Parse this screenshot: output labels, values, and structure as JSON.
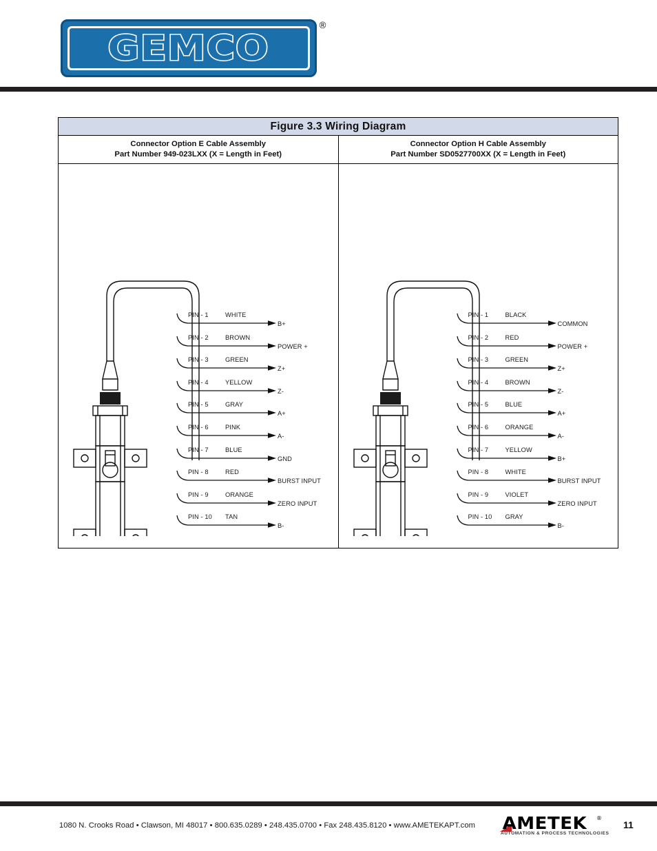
{
  "header": {
    "logo_text": "GEMCO",
    "logo_registered_mark": "®"
  },
  "figure": {
    "title": "Figure 3.3  Wiring Diagram",
    "columns": [
      {
        "heading_line1": "Connector Option E Cable Assembly",
        "heading_line2": "Part Number 949-023LXX  (X = Length in Feet)",
        "pins": [
          {
            "pin": "PIN - 1",
            "color": "WHITE",
            "signal": "B+"
          },
          {
            "pin": "PIN - 2",
            "color": "BROWN",
            "signal": "POWER +"
          },
          {
            "pin": "PIN - 3",
            "color": "GREEN",
            "signal": "Z+"
          },
          {
            "pin": "PIN - 4",
            "color": "YELLOW",
            "signal": "Z-"
          },
          {
            "pin": "PIN - 5",
            "color": "GRAY",
            "signal": "A+"
          },
          {
            "pin": "PIN - 6",
            "color": "PINK",
            "signal": "A-"
          },
          {
            "pin": "PIN - 7",
            "color": "BLUE",
            "signal": "GND"
          },
          {
            "pin": "PIN - 8",
            "color": "RED",
            "signal": "BURST INPUT"
          },
          {
            "pin": "PIN - 9",
            "color": "ORANGE",
            "signal": "ZERO INPUT"
          },
          {
            "pin": "PIN - 10",
            "color": "TAN",
            "signal": "B-"
          }
        ]
      },
      {
        "heading_line1": "Connector Option H Cable Assembly",
        "heading_line2": "Part Number SD0527700XX  (X = Length in Feet)",
        "pins": [
          {
            "pin": "PIN - 1",
            "color": "BLACK",
            "signal": "COMMON"
          },
          {
            "pin": "PIN - 2",
            "color": "RED",
            "signal": "POWER +"
          },
          {
            "pin": "PIN - 3",
            "color": "GREEN",
            "signal": "Z+"
          },
          {
            "pin": "PIN - 4",
            "color": "BROWN",
            "signal": "Z-"
          },
          {
            "pin": "PIN - 5",
            "color": "BLUE",
            "signal": "A+"
          },
          {
            "pin": "PIN - 6",
            "color": "ORANGE",
            "signal": "A-"
          },
          {
            "pin": "PIN - 7",
            "color": "YELLOW",
            "signal": "B+"
          },
          {
            "pin": "PIN - 8",
            "color": "WHITE",
            "signal": "BURST INPUT"
          },
          {
            "pin": "PIN - 9",
            "color": "VIOLET",
            "signal": "ZERO INPUT"
          },
          {
            "pin": "PIN - 10",
            "color": "GRAY",
            "signal": "B-"
          }
        ]
      }
    ]
  },
  "footer": {
    "address": "1080 N. Crooks Road  •  Clawson, MI  48017  •  800.635.0289  •  248.435.0700  •  Fax 248.435.8120  •  www.AMETEKAPT.com",
    "brand": "AMETEK",
    "brand_registered_mark": "®",
    "tagline": "AUTOMATION & PROCESS TECHNOLOGIES",
    "page_number": "11"
  },
  "colors": {
    "logo_blue": "#1b6fab",
    "header_band": "#d2dae9",
    "rule_dark": "#231f20",
    "accent_red": "#cc2026"
  }
}
